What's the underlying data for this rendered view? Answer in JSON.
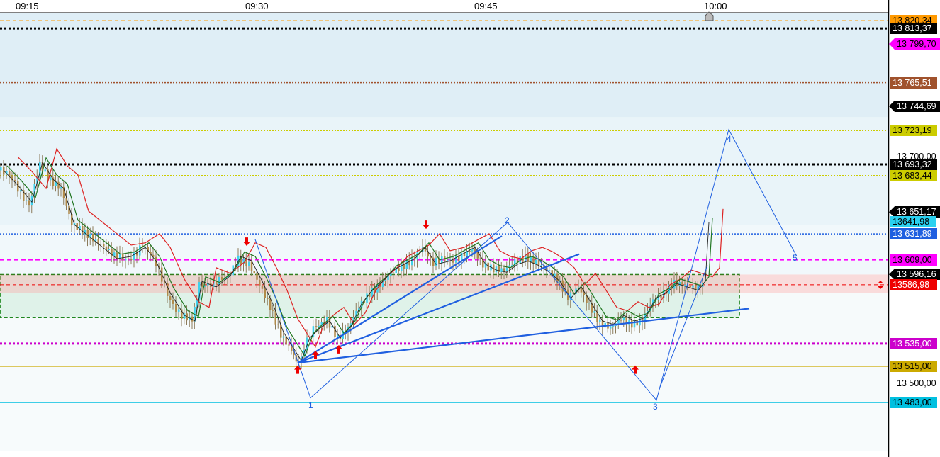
{
  "chart_data": {
    "type": "candlestick",
    "title": "",
    "time_axis": [
      "09:15",
      "09:30",
      "09:45",
      "10:00"
    ],
    "ylim": [
      13440,
      13835
    ],
    "price_axis_ticks": [
      "13 700,00",
      "13 500,00"
    ],
    "current_price": "13641,98",
    "level_lines": [
      {
        "label": "13 820,34",
        "price": 13820.34,
        "color": "#ff9900",
        "style": "dashed",
        "tag": "box"
      },
      {
        "label": "13 813,37",
        "price": 13813.37,
        "color": "#000000",
        "style": "dotted-bold",
        "tag": "box"
      },
      {
        "label": "13 799,70",
        "price": 13799.7,
        "color": "#ff00ff",
        "style": "none",
        "tag": "arrow"
      },
      {
        "label": "13 765,51",
        "price": 13765.51,
        "color": "#a0522d",
        "style": "dotted",
        "tag": "box"
      },
      {
        "label": "13 744,69",
        "price": 13744.69,
        "color": "#000000",
        "style": "none",
        "tag": "arrow"
      },
      {
        "label": "13 723,19",
        "price": 13723.19,
        "color": "#cccc00",
        "style": "dotted",
        "tag": "box"
      },
      {
        "label": "13 693,32",
        "price": 13693.32,
        "color": "#000000",
        "style": "dotted-bold",
        "tag": "box"
      },
      {
        "label": "13 683,44",
        "price": 13683.44,
        "color": "#cccc00",
        "style": "dotted",
        "tag": "box"
      },
      {
        "label": "13 651,17",
        "price": 13651.17,
        "color": "#000000",
        "style": "none",
        "tag": "arrow"
      },
      {
        "label": "13 631,89",
        "price": 13631.89,
        "color": "#1f5fe0",
        "style": "dotted",
        "tag": "box"
      },
      {
        "label": "13 609,00",
        "price": 13609.0,
        "color": "#ff00ff",
        "style": "dashed-bold",
        "tag": "box"
      },
      {
        "label": "13 596,16",
        "price": 13596.16,
        "color": "#000000",
        "style": "none",
        "tag": "arrow"
      },
      {
        "label": "13586,98",
        "price": 13586.98,
        "color": "#ee0000",
        "style": "dashed",
        "tag": "box"
      },
      {
        "label": "13 535,00",
        "price": 13535.0,
        "color": "#cc00cc",
        "style": "dotted-bold",
        "tag": "box"
      },
      {
        "label": "13 515,00",
        "price": 13515.0,
        "color": "#ccaa00",
        "style": "solid",
        "tag": "box"
      },
      {
        "label": "13 483,00",
        "price": 13483.0,
        "color": "#00c0e0",
        "style": "solid",
        "tag": "box"
      }
    ],
    "wave_labels": [
      "1",
      "2",
      "3",
      "4",
      "5"
    ],
    "zone": {
      "top": 13596,
      "bottom": 13558
    },
    "bands": [
      {
        "from": 13840,
        "to": 13735,
        "color": "#dfeef6"
      },
      {
        "from": 13735,
        "to": 13640,
        "color": "#e9f4f9"
      },
      {
        "from": 13640,
        "to": 13596,
        "color": "#f1f8fb"
      },
      {
        "from": 13596,
        "to": 13483,
        "color": "#f6fafb"
      },
      {
        "from": 13483,
        "to": 13440,
        "color": "#f7fbfc"
      }
    ],
    "candle_path": [
      [
        0,
        13688
      ],
      [
        20,
        13675
      ],
      [
        40,
        13660
      ],
      [
        55,
        13695
      ],
      [
        70,
        13680
      ],
      [
        85,
        13672
      ],
      [
        100,
        13640
      ],
      [
        130,
        13625
      ],
      [
        160,
        13610
      ],
      [
        180,
        13612
      ],
      [
        200,
        13620
      ],
      [
        215,
        13608
      ],
      [
        235,
        13580
      ],
      [
        255,
        13560
      ],
      [
        270,
        13555
      ],
      [
        280,
        13590
      ],
      [
        300,
        13585
      ],
      [
        320,
        13595
      ],
      [
        335,
        13612
      ],
      [
        350,
        13608
      ],
      [
        365,
        13590
      ],
      [
        380,
        13570
      ],
      [
        395,
        13545
      ],
      [
        410,
        13530
      ],
      [
        420,
        13520
      ],
      [
        432,
        13540
      ],
      [
        445,
        13548
      ],
      [
        460,
        13555
      ],
      [
        475,
        13540
      ],
      [
        490,
        13550
      ],
      [
        505,
        13570
      ],
      [
        520,
        13582
      ],
      [
        535,
        13590
      ],
      [
        550,
        13600
      ],
      [
        565,
        13605
      ],
      [
        580,
        13610
      ],
      [
        595,
        13620
      ],
      [
        610,
        13605
      ],
      [
        630,
        13608
      ],
      [
        650,
        13615
      ],
      [
        665,
        13620
      ],
      [
        680,
        13605
      ],
      [
        695,
        13600
      ],
      [
        710,
        13598
      ],
      [
        725,
        13605
      ],
      [
        740,
        13608
      ],
      [
        755,
        13604
      ],
      [
        770,
        13598
      ],
      [
        785,
        13590
      ],
      [
        800,
        13575
      ],
      [
        815,
        13585
      ],
      [
        830,
        13570
      ],
      [
        845,
        13555
      ],
      [
        860,
        13552
      ],
      [
        875,
        13560
      ],
      [
        890,
        13555
      ],
      [
        905,
        13558
      ],
      [
        920,
        13575
      ],
      [
        935,
        13580
      ],
      [
        950,
        13588
      ],
      [
        965,
        13585
      ],
      [
        980,
        13582
      ],
      [
        990,
        13590
      ],
      [
        995,
        13641.98
      ]
    ],
    "markers": [
      {
        "type": "sell",
        "x": 348,
        "price": 13625
      },
      {
        "type": "buy",
        "x": 420,
        "price": 13512
      },
      {
        "type": "buy",
        "x": 445,
        "price": 13525
      },
      {
        "type": "buy",
        "x": 478,
        "price": 13530
      },
      {
        "type": "sell",
        "x": 601,
        "price": 13640
      },
      {
        "type": "buy",
        "x": 896,
        "price": 13512
      }
    ]
  }
}
